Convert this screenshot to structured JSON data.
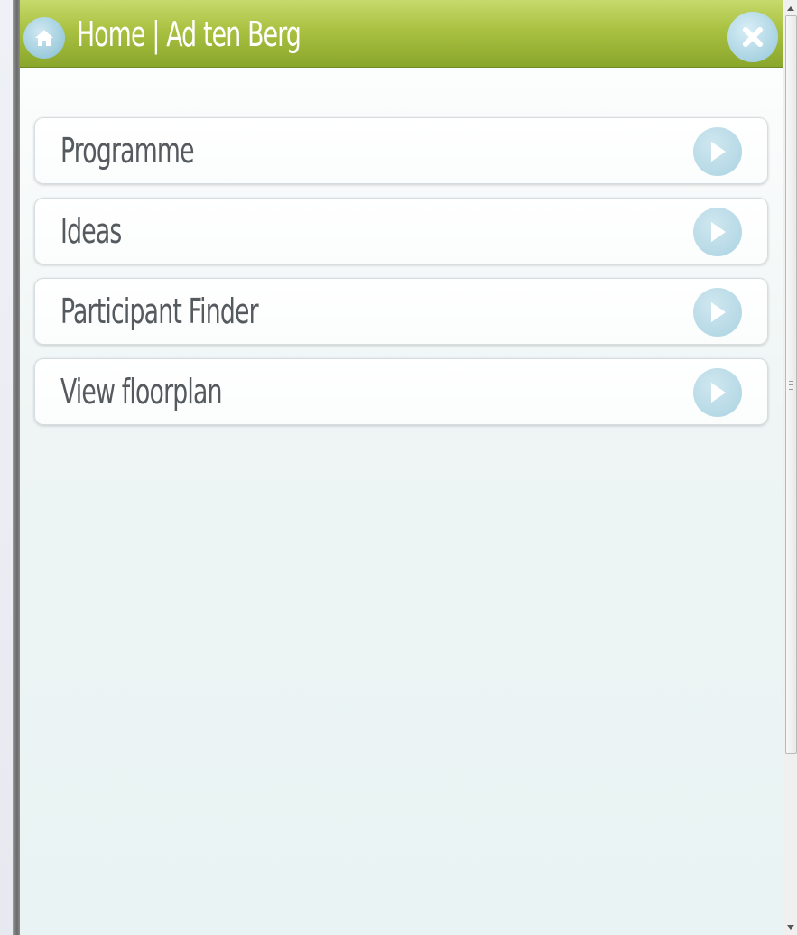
{
  "header": {
    "title": "Home | Ad ten Berg",
    "home_icon": "home-icon",
    "close_icon": "close-icon",
    "accent_color": "#a9c141"
  },
  "menu": {
    "items": [
      {
        "label": "Programme",
        "icon": "chevron-right-icon"
      },
      {
        "label": "Ideas",
        "icon": "chevron-right-icon"
      },
      {
        "label": "Participant Finder",
        "icon": "chevron-right-icon"
      },
      {
        "label": "View floorplan",
        "icon": "chevron-right-icon"
      }
    ]
  },
  "scrollbar": {
    "up_icon": "scroll-up-arrow-icon",
    "down_icon": "scroll-down-arrow-icon"
  }
}
